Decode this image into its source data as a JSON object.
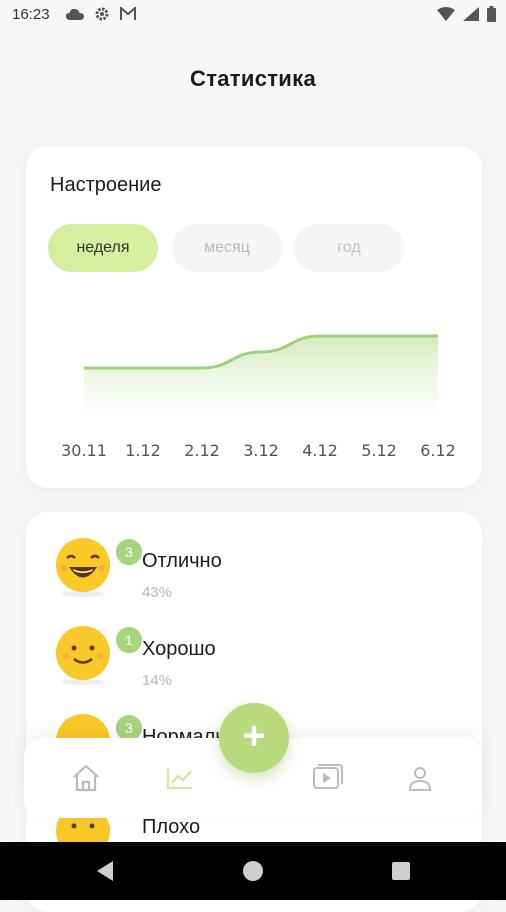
{
  "status_bar": {
    "time": "16:23"
  },
  "page": {
    "title": "Статистика"
  },
  "mood_card": {
    "title": "Настроение",
    "periods": [
      "неделя",
      "месяц",
      "год"
    ],
    "selected_period": "неделя"
  },
  "chart_data": {
    "type": "area",
    "x": [
      "30.11",
      "1.12",
      "2.12",
      "3.12",
      "4.12",
      "5.12",
      "6.12"
    ],
    "series": [
      {
        "values": [
          2.2,
          2.2,
          2.2,
          2.6,
          3.0,
          3.0,
          3.0
        ]
      }
    ],
    "ylim": [
      1,
      4
    ],
    "color": "#9fd07a",
    "grid": false
  },
  "moods": [
    {
      "name": "Отлично",
      "percent": "43%",
      "count": "3"
    },
    {
      "name": "Хорошо",
      "percent": "14%",
      "count": "1"
    },
    {
      "name": "Нормально",
      "percent": "",
      "count": "3"
    },
    {
      "name": "Плохо",
      "percent": "",
      "count": ""
    }
  ],
  "fab": {
    "label": "+"
  },
  "colors": {
    "accent": "#b7db7c",
    "selected_pill": "#d8ee9f",
    "badge": "#a6d67c"
  }
}
